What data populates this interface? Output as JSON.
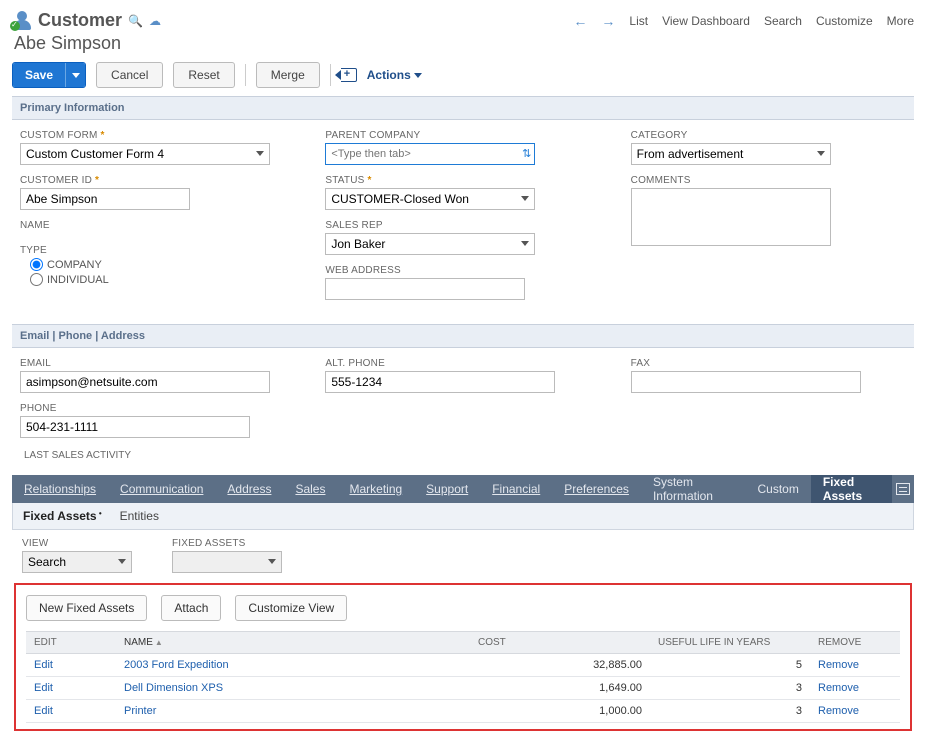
{
  "header": {
    "record_type": "Customer",
    "record_name": "Abe Simpson",
    "nav": [
      "List",
      "View Dashboard",
      "Search",
      "Customize",
      "More"
    ]
  },
  "actionbar": {
    "save": "Save",
    "cancel": "Cancel",
    "reset": "Reset",
    "merge": "Merge",
    "actions": "Actions"
  },
  "sections": {
    "primary": "Primary Information",
    "contact": "Email | Phone | Address"
  },
  "fields": {
    "custom_form": {
      "label": "CUSTOM FORM",
      "value": "Custom Customer Form 4"
    },
    "customer_id": {
      "label": "CUSTOMER ID",
      "value": "Abe Simpson"
    },
    "name": {
      "label": "NAME",
      "value": ""
    },
    "type": {
      "label": "TYPE",
      "company": "COMPANY",
      "individual": "INDIVIDUAL"
    },
    "parent_company": {
      "label": "PARENT COMPANY",
      "placeholder": "<Type then tab>"
    },
    "status": {
      "label": "STATUS",
      "value": "CUSTOMER-Closed Won"
    },
    "sales_rep": {
      "label": "SALES REP",
      "value": "Jon Baker"
    },
    "web_address": {
      "label": "WEB ADDRESS",
      "value": ""
    },
    "category": {
      "label": "CATEGORY",
      "value": "From advertisement"
    },
    "comments": {
      "label": "COMMENTS",
      "value": ""
    },
    "email": {
      "label": "EMAIL",
      "value": "asimpson@netsuite.com"
    },
    "phone": {
      "label": "PHONE",
      "value": "504-231-1111"
    },
    "alt_phone": {
      "label": "ALT. PHONE",
      "value": "555-1234"
    },
    "fax": {
      "label": "FAX",
      "value": ""
    },
    "last_sales": {
      "label": "LAST SALES ACTIVITY"
    }
  },
  "tabs": [
    "Relationships",
    "Communication",
    "Address",
    "Sales",
    "Marketing",
    "Support",
    "Financial",
    "Preferences",
    "System Information",
    "Custom",
    "Fixed Assets"
  ],
  "active_tab": "Fixed Assets",
  "subtabs": {
    "fixed": "Fixed Assets",
    "entities": "Entities"
  },
  "filters": {
    "view": {
      "label": "VIEW",
      "value": "Search"
    },
    "fixed_assets": {
      "label": "FIXED ASSETS",
      "value": ""
    }
  },
  "list_actions": {
    "new": "New Fixed Assets",
    "attach": "Attach",
    "customize": "Customize View"
  },
  "table": {
    "cols": {
      "edit": "EDIT",
      "name": "NAME",
      "cost": "COST",
      "life": "USEFUL LIFE IN YEARS",
      "remove": "REMOVE"
    },
    "rows": [
      {
        "edit": "Edit",
        "name": "2003 Ford Expedition",
        "cost": "32,885.00",
        "life": "5",
        "remove": "Remove"
      },
      {
        "edit": "Edit",
        "name": "Dell Dimension XPS",
        "cost": "1,649.00",
        "life": "3",
        "remove": "Remove"
      },
      {
        "edit": "Edit",
        "name": "Printer",
        "cost": "1,000.00",
        "life": "3",
        "remove": "Remove"
      }
    ]
  }
}
